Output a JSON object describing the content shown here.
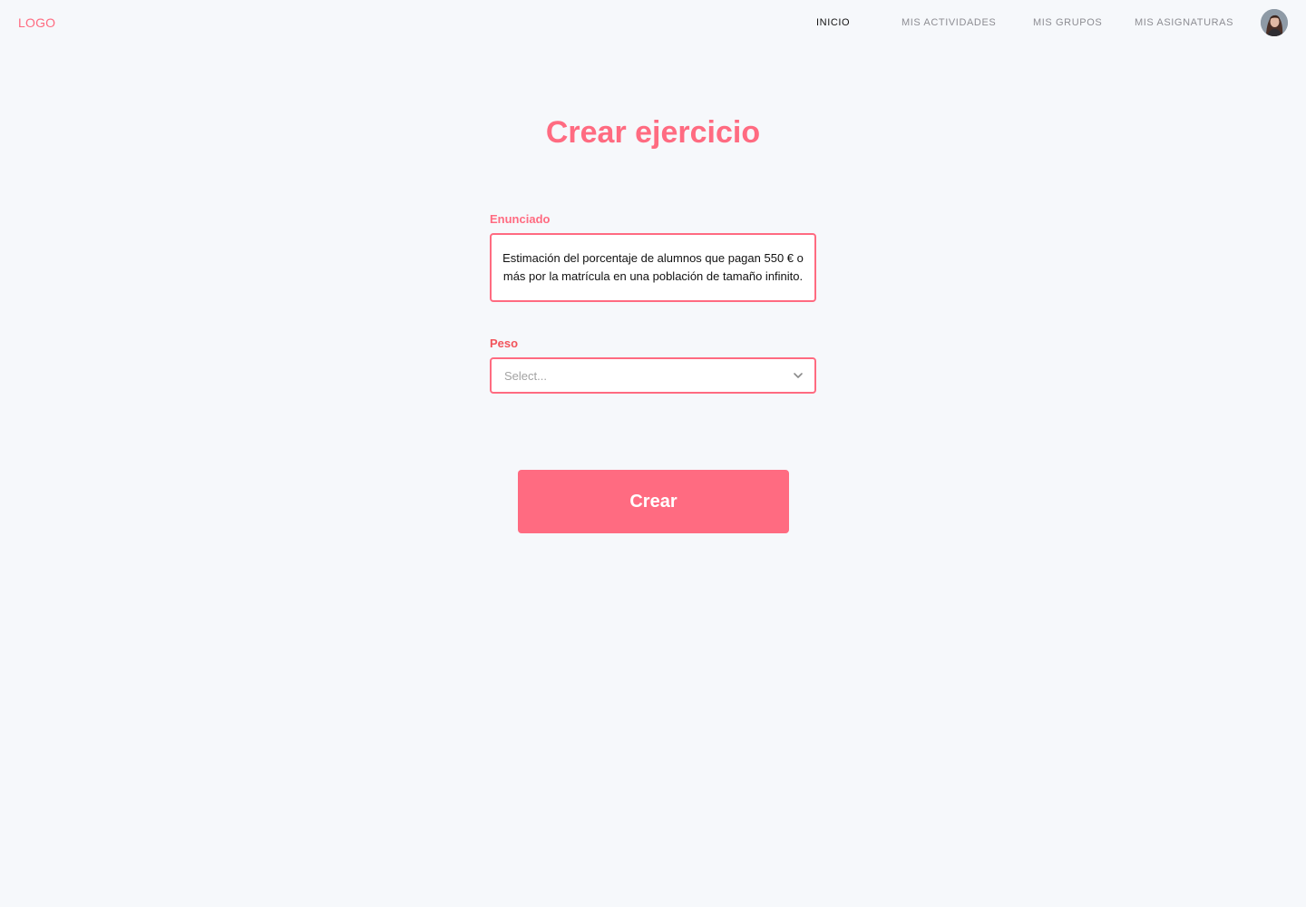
{
  "header": {
    "logo": "LOGO",
    "nav": [
      {
        "label": "INICIO",
        "active": true
      },
      {
        "label": "MIS ACTIVIDADES",
        "active": false
      },
      {
        "label": "MIS GRUPOS",
        "active": false
      },
      {
        "label": "MIS ASIGNATURAS",
        "active": false
      }
    ],
    "avatar_icon": "user-avatar-photo"
  },
  "main": {
    "title": "Crear ejercicio",
    "enunciado": {
      "label": "Enunciado",
      "value": "Estimación del porcentaje de alumnos que pagan 550 € o más por la matrícula en una población de tamaño infinito."
    },
    "peso": {
      "label": "Peso",
      "placeholder": "Select..."
    },
    "submit_label": "Crear"
  },
  "colors": {
    "accent": "#ff6b81",
    "background": "#f6f8fb",
    "nav_active": "#111111",
    "nav_inactive": "#8d8d93"
  }
}
